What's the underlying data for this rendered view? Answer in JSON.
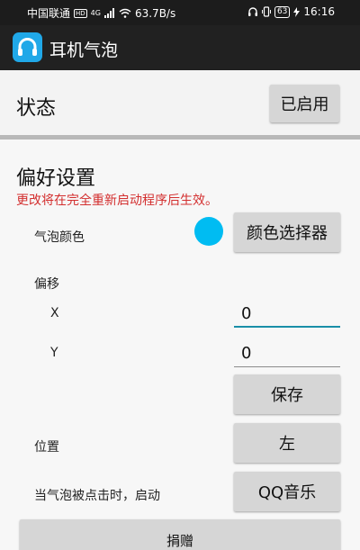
{
  "status_bar": {
    "carrier": "中国联通",
    "hd_badge": "HD",
    "network": "4G",
    "speed": "63.7B/s",
    "battery": "63",
    "time": "16:16"
  },
  "app_bar": {
    "title": "耳机气泡",
    "icon": "headphones-icon"
  },
  "status": {
    "label": "状态",
    "toggle_label": "已启用"
  },
  "preferences": {
    "title": "偏好设置",
    "warning": "更改将在完全重新启动程序后生效。",
    "warning_color": "#d32f2f",
    "bubble_color": {
      "label": "气泡颜色",
      "color": "#00bcf2",
      "button_label": "颜色选择器"
    },
    "offset": {
      "label": "偏移",
      "x_label": "X",
      "x_value": "0",
      "y_label": "Y",
      "y_value": "0",
      "save_label": "保存"
    },
    "position": {
      "label": "位置",
      "value": "左"
    },
    "on_click": {
      "label": "当气泡被点击时，启动",
      "value": "QQ音乐"
    },
    "donate_label": "捐赠"
  }
}
